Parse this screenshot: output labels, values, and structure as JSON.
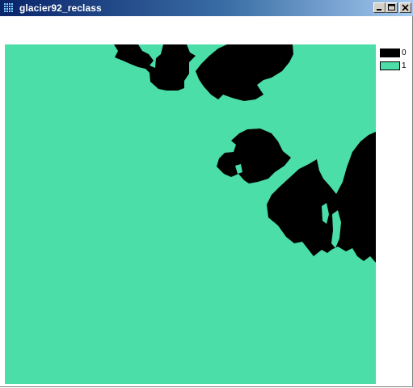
{
  "window": {
    "title": "glacier92_reclass",
    "icon": "raster-grid-icon",
    "buttons": [
      "minimize",
      "maximize",
      "close"
    ]
  },
  "colors": {
    "class_0": "#000000",
    "class_1": "#4bdea8",
    "titlebar_start": "#0a246a",
    "titlebar_end": "#a6caf0"
  },
  "legend": {
    "items": [
      {
        "label": "0",
        "color": "#000000"
      },
      {
        "label": "1",
        "color": "#4bdea8"
      }
    ]
  }
}
